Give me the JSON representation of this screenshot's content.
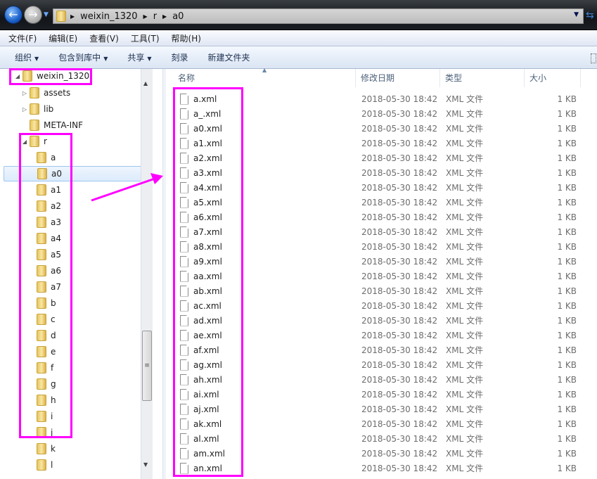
{
  "address": {
    "path": [
      "weixin_1320",
      "r",
      "a0"
    ]
  },
  "menu": [
    "文件(F)",
    "编辑(E)",
    "查看(V)",
    "工具(T)",
    "帮助(H)"
  ],
  "toolbar": [
    {
      "label": "组织",
      "dd": true
    },
    {
      "label": "包含到库中",
      "dd": true
    },
    {
      "label": "共享",
      "dd": true
    },
    {
      "label": "刻录",
      "dd": false
    },
    {
      "label": "新建文件夹",
      "dd": false
    }
  ],
  "tree": {
    "root": "weixin_1320",
    "top": [
      {
        "label": "assets",
        "exp": "▷"
      },
      {
        "label": "lib",
        "exp": "▷"
      },
      {
        "label": "META-INF",
        "exp": ""
      },
      {
        "label": "r",
        "exp": "◢"
      }
    ],
    "r_children": [
      "a",
      "a0",
      "a1",
      "a2",
      "a3",
      "a4",
      "a5",
      "a6",
      "a7",
      "b",
      "c",
      "d",
      "e",
      "f",
      "g",
      "h",
      "i",
      "j",
      "k",
      "l"
    ],
    "selected": "a0"
  },
  "columns": {
    "name": "名称",
    "date": "修改日期",
    "type": "类型",
    "size": "大小"
  },
  "files": [
    "a.xml",
    "a_.xml",
    "a0.xml",
    "a1.xml",
    "a2.xml",
    "a3.xml",
    "a4.xml",
    "a5.xml",
    "a6.xml",
    "a7.xml",
    "a8.xml",
    "a9.xml",
    "aa.xml",
    "ab.xml",
    "ac.xml",
    "ad.xml",
    "ae.xml",
    "af.xml",
    "ag.xml",
    "ah.xml",
    "ai.xml",
    "aj.xml",
    "ak.xml",
    "al.xml",
    "am.xml",
    "an.xml"
  ],
  "file_date": "2018-05-30 18:42",
  "file_type": "XML 文件",
  "file_size": "1 KB",
  "annotation_color": "#ff00ff"
}
